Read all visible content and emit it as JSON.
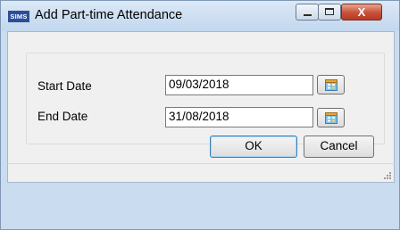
{
  "window": {
    "app_icon_text": "SIMS",
    "title": "Add Part-time Attendance",
    "close_glyph": "X"
  },
  "form": {
    "start_date_label": "Start Date",
    "start_date_value": "09/03/2018",
    "end_date_label": "End Date",
    "end_date_value": "31/08/2018"
  },
  "buttons": {
    "ok_label": "OK",
    "cancel_label": "Cancel"
  },
  "icons": {
    "calendar": "calendar-icon",
    "minimize": "minimize-icon",
    "maximize": "maximize-icon",
    "close": "close-icon",
    "resize": "resize-grip-icon"
  },
  "colors": {
    "frame": "#c9dcf0",
    "close_button": "#c9503a",
    "content": "#f0f0f0"
  }
}
